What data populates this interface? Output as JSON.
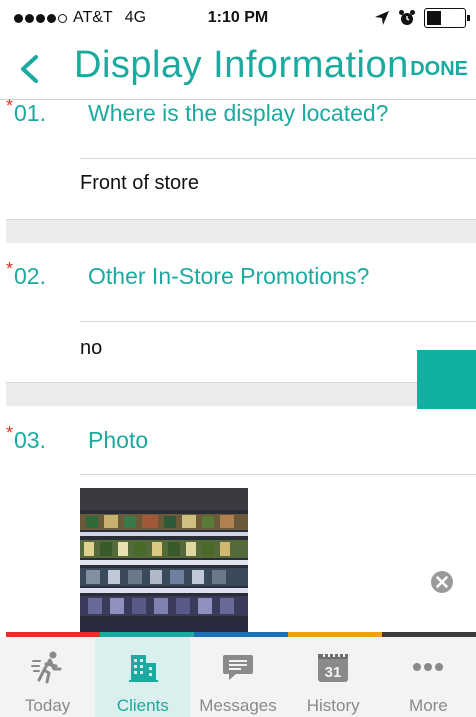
{
  "status_bar": {
    "carrier": "AT&T",
    "network": "4G",
    "time": "1:10 PM"
  },
  "nav": {
    "title": "Display Information",
    "done_label": "DONE"
  },
  "questions": [
    {
      "required_mark": "*",
      "number": "01.",
      "question": "Where is the display located?",
      "answer": "Front of store"
    },
    {
      "required_mark": "*",
      "number": "02.",
      "question": "Other In-Store Promotions?",
      "answer": "no"
    },
    {
      "required_mark": "*",
      "number": "03.",
      "question": "Photo"
    }
  ],
  "tab_bar": {
    "active": "Clients",
    "accent_colors": [
      "#e0322a",
      "#1aaa9f",
      "#1f6fb6",
      "#f0a020",
      "#3c3c3c"
    ],
    "tabs": [
      {
        "label": "Today",
        "icon": "walking-person-icon"
      },
      {
        "label": "Clients",
        "icon": "building-icon"
      },
      {
        "label": "Messages",
        "icon": "chat-bubble-icon"
      },
      {
        "label": "History",
        "icon": "calendar-icon",
        "icon_text": "31"
      },
      {
        "label": "More",
        "icon": "more-dots-icon"
      }
    ]
  },
  "colors": {
    "accent": "#1aaa9f",
    "required": "#e0322a"
  }
}
